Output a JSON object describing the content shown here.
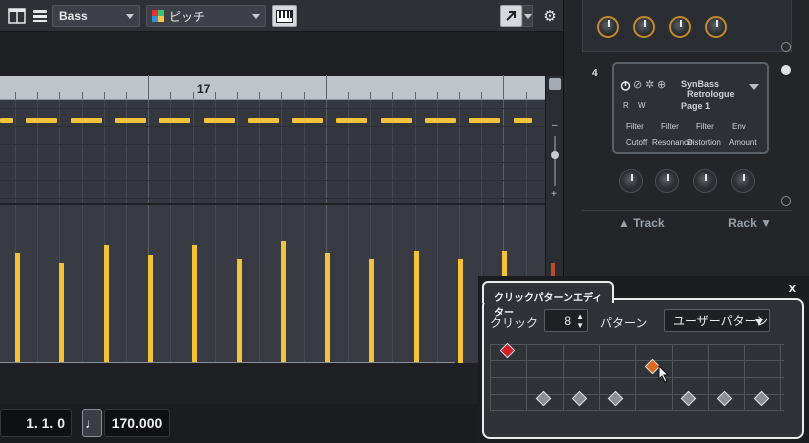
{
  "toolbar": {
    "track_name": "Bass",
    "view_mode": "ピッチ"
  },
  "ruler": {
    "bar_label": "17"
  },
  "status": {
    "position": "1.  1.   0",
    "tempo": "170.000"
  },
  "rack": {
    "slot_number": "4",
    "instrument_brand": "SynBass",
    "instrument_name": "Retrologue",
    "page_label": "Page 1",
    "r_label": "R",
    "w_label": "W",
    "param_top": [
      "Filter",
      "Filter",
      "Filter",
      "Env"
    ],
    "param_bottom": [
      "Cutoff",
      "Resonance",
      "Distortion",
      "Amount"
    ],
    "track_button": "Track",
    "rack_button": "Rack"
  },
  "dialog": {
    "title": "クリックパターンエディター",
    "close": "x",
    "click_label": "クリック",
    "click_value": "8",
    "pattern_label": "パターン",
    "pattern_value": "ユーザーパターン"
  },
  "colors": {
    "note": "#f2c23b",
    "accent_high": "#cf2027",
    "accent_mid": "#de6a1f",
    "accent_low": "#8a8e94"
  },
  "icons": [
    "track-list-icon",
    "layers-icon",
    "color-icon",
    "piano-keys-icon",
    "arrow-tool-icon",
    "gear-icon",
    "power-icon",
    "edit-icon",
    "cursor-icon"
  ]
}
